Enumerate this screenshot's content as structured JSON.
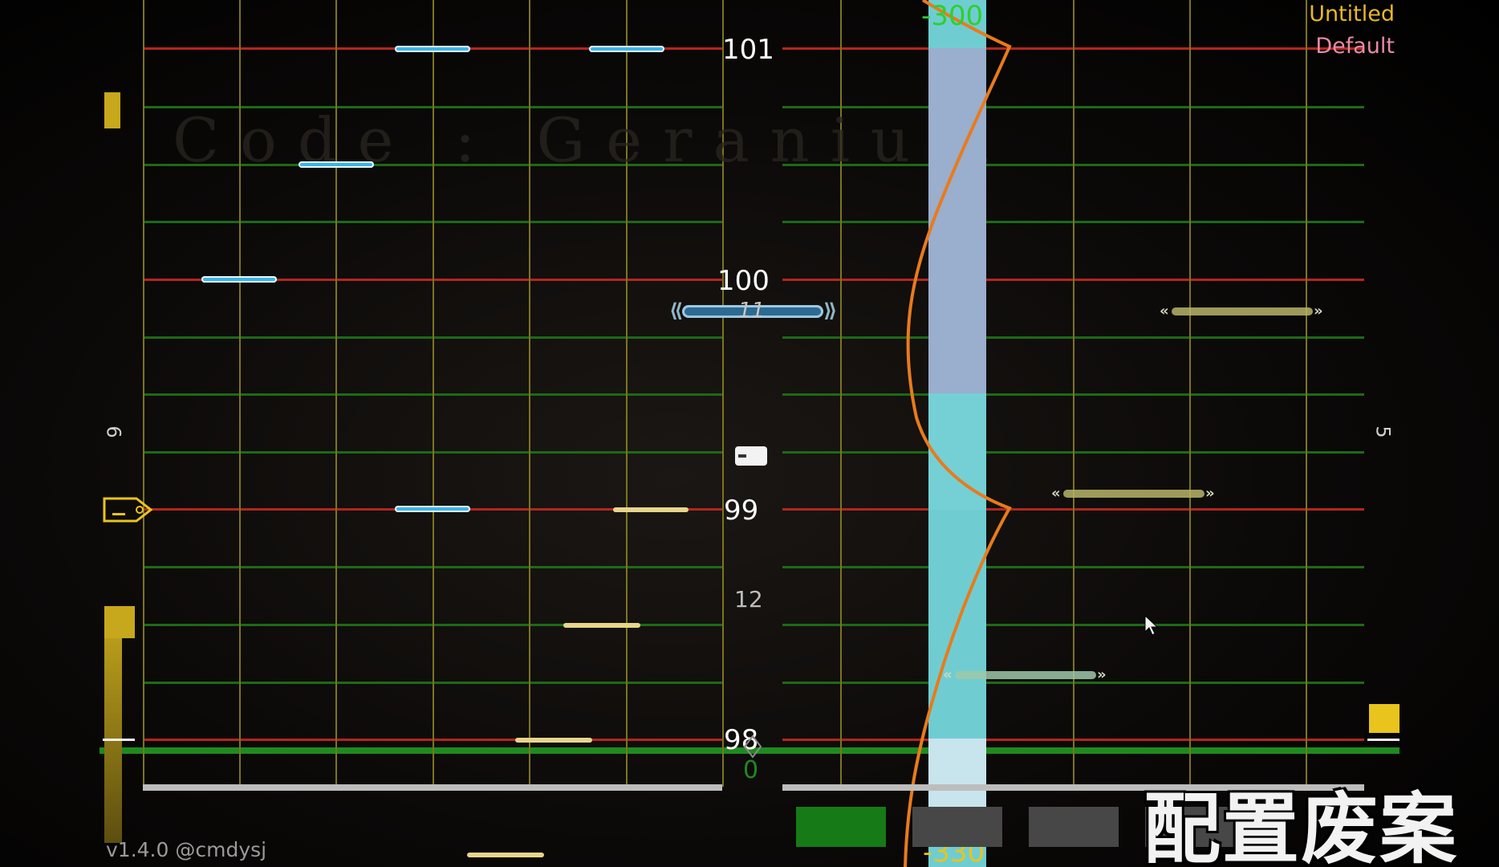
{
  "song": {
    "title": "Untitled",
    "difficulty": "Default",
    "faint_title": "Code : Geranium"
  },
  "measures": [
    "101",
    "100",
    "99",
    "98"
  ],
  "beat_labels": {
    "upper": "11",
    "lower": "12"
  },
  "side_numbers": {
    "left": "6",
    "right": "5"
  },
  "speed": {
    "top": "-300",
    "bottom": "-330",
    "zero": "0"
  },
  "version": "v1.4.0 @cmdysj",
  "watermark": "配置废案",
  "buttons": [
    {
      "name": "green",
      "active": true
    },
    {
      "name": "gray-1",
      "active": false
    },
    {
      "name": "gray-2",
      "active": false
    }
  ],
  "colors": {
    "beat_line": "#b3261e",
    "sub_line": "#1d6a16",
    "column": "#7d7420",
    "tap_note": "#38b6e8",
    "drag_note": "#e8d58a",
    "speed_curve": "#e87b1c",
    "speed_lane": "#6fd0d6",
    "title": "#e8b923",
    "difficulty": "#e88aa8"
  }
}
